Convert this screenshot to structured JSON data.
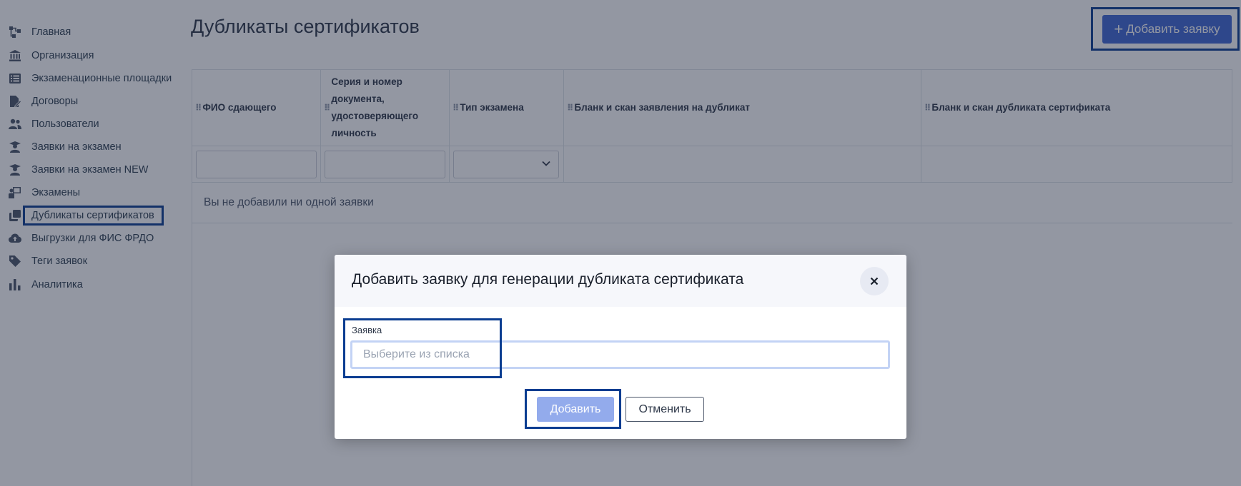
{
  "sidebar": {
    "items": [
      {
        "label": "Главная",
        "icon": "flowchart-icon"
      },
      {
        "label": "Организация",
        "icon": "bank-icon"
      },
      {
        "label": "Экзаменационные площадки",
        "icon": "list-icon"
      },
      {
        "label": "Договоры",
        "icon": "file-sign-icon"
      },
      {
        "label": "Пользователи",
        "icon": "users-icon"
      },
      {
        "label": "Заявки на экзамен",
        "icon": "student-icon"
      },
      {
        "label": "Заявки на экзамен NEW",
        "icon": "student-icon"
      },
      {
        "label": "Экзамены",
        "icon": "teacher-board-icon"
      },
      {
        "label": "Дубликаты сертификатов",
        "icon": "copy-icon"
      },
      {
        "label": "Выгрузки для ФИС ФРДО",
        "icon": "cloud-upload-icon"
      },
      {
        "label": "Теги заявок",
        "icon": "tag-icon"
      },
      {
        "label": "Аналитика",
        "icon": "bar-chart-icon"
      }
    ],
    "active_index": 8
  },
  "header": {
    "title": "Дубликаты сертификатов",
    "add_button": "Добавить заявку",
    "add_button_icon": "plus-icon"
  },
  "table": {
    "columns": [
      "ФИО сдающего",
      "Серия и номер документа, удостоверяющего личность",
      "Тип экзамена",
      "Бланк и скан заявления на дубликат",
      "Бланк и скан дубликата сертификата"
    ],
    "empty_message": "Вы не добавили ни одной заявки"
  },
  "modal": {
    "title": "Добавить заявку для генерации дубликата сертификата",
    "field_label": "Заявка",
    "field_placeholder": "Выберите из списка",
    "add_button": "Добавить",
    "cancel_button": "Отменить"
  },
  "colors": {
    "accent": "#3f67d4",
    "highlight_frame": "#0b3d91",
    "disabled_button": "#93abec"
  }
}
